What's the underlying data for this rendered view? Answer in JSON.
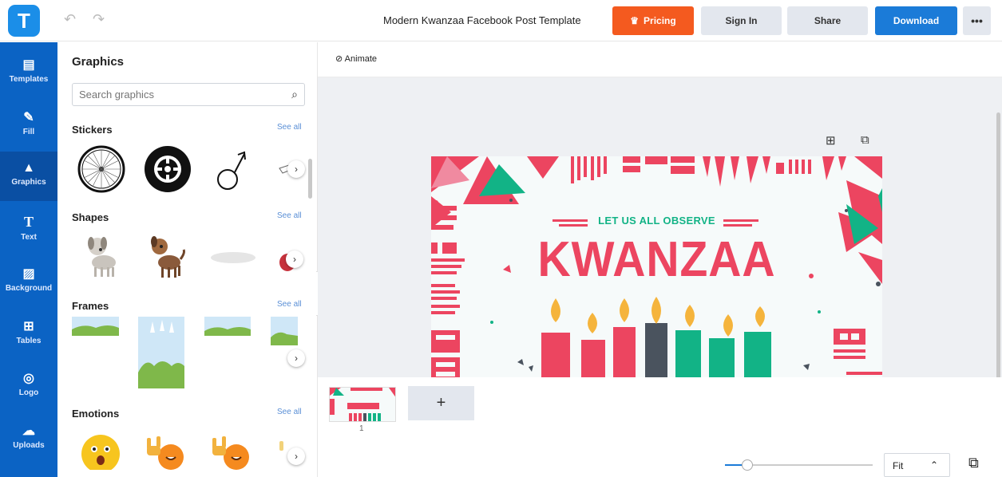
{
  "header": {
    "logo_letter": "T",
    "title": "Modern Kwanzaa Facebook Post Template",
    "pricing": "Pricing",
    "sign_in": "Sign In",
    "share": "Share",
    "download": "Download",
    "more": "•••"
  },
  "nav": {
    "items": [
      {
        "label": "Templates",
        "icon": "templates-icon"
      },
      {
        "label": "Fill",
        "icon": "brush-icon"
      },
      {
        "label": "Graphics",
        "icon": "shapes-icon"
      },
      {
        "label": "Text",
        "icon": "text-icon"
      },
      {
        "label": "Background",
        "icon": "background-icon"
      },
      {
        "label": "Tables",
        "icon": "table-icon"
      },
      {
        "label": "Logo",
        "icon": "logo-icon"
      },
      {
        "label": "Uploads",
        "icon": "upload-icon"
      }
    ]
  },
  "panel": {
    "title": "Graphics",
    "search_placeholder": "Search graphics",
    "see_all": "See all",
    "sections": [
      "Stickers",
      "Shapes",
      "Frames",
      "Emotions"
    ]
  },
  "workspace": {
    "animate": "Animate",
    "design": {
      "subtitle": "LET US ALL OBSERVE",
      "headline": "KWANZAA"
    },
    "page_number": "1",
    "add_page": "+",
    "zoom": "Fit",
    "zoom_level": 0.15
  },
  "colors": {
    "brand_blue": "#1b7bd8",
    "nav_blue": "#0b63c4",
    "pricing_orange": "#f45a1f",
    "kwanzaa_red": "#ec4560",
    "kwanzaa_green": "#12b386",
    "candle_gray": "#4a535e",
    "flame": "#f5b43c"
  }
}
